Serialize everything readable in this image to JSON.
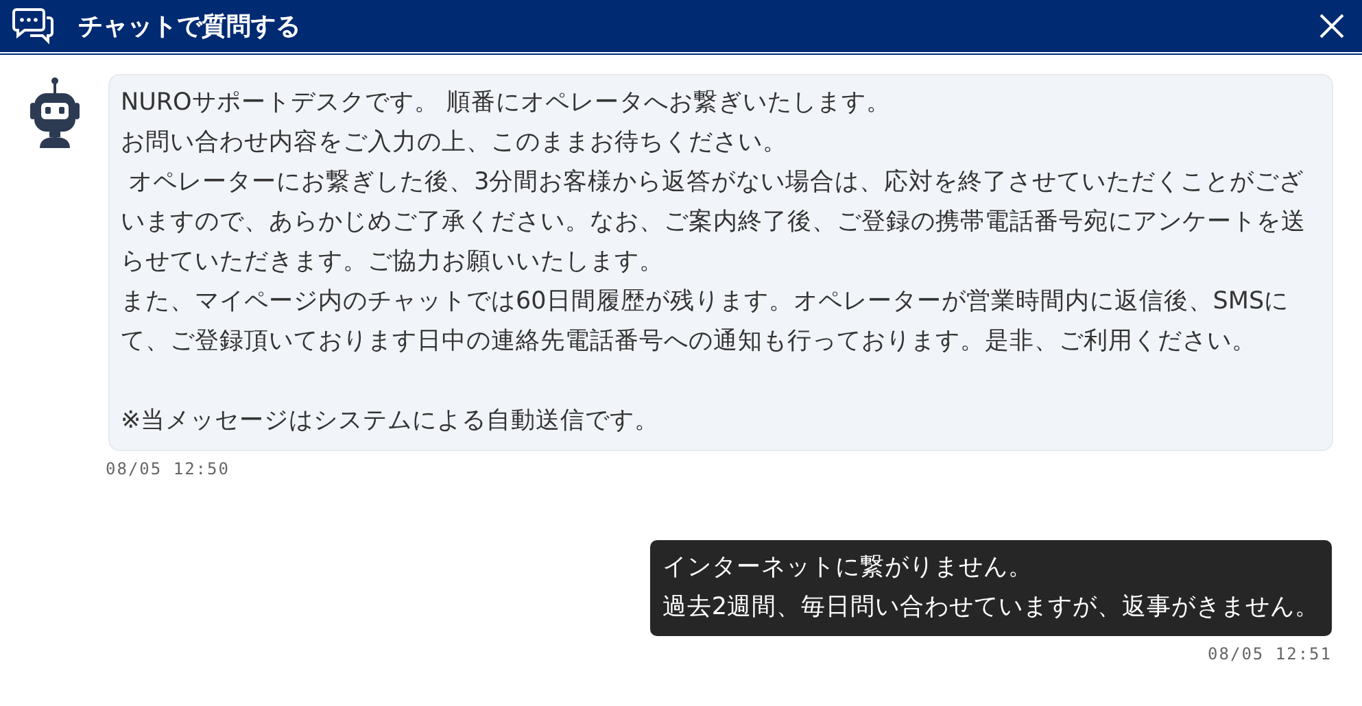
{
  "header": {
    "title": "チャットで質問する"
  },
  "messages": [
    {
      "kind": "bot",
      "paragraphs": [
        "NUROサポートデスクです。 順番にオペレータへお繋ぎいたします。",
        "お問い合わせ内容をご入力の上、このままお待ちください。",
        " オペレーターにお繋ぎした後、3分間お客様から返答がない場合は、応対を終了させていただくことがございますので、あらかじめご了承ください。なお、ご案内終了後、ご登録の携帯電話番号宛にアンケートを送らせていただきます。ご協力お願いいたします。",
        "また、マイページ内のチャットでは60日間履歴が残ります。オペレーターが営業時間内に返信後、SMSにて、ご登録頂いております日中の連絡先電話番号への通知も行っております。是非、ご利用ください。"
      ],
      "note": "※当メッセージはシステムによる自動送信です。",
      "time": "08/05 12:50"
    },
    {
      "kind": "user",
      "paragraphs": [
        "インターネットに繋がりません。",
        "過去2週間、毎日問い合わせていますが、返事がきません。"
      ],
      "time": "08/05 12:51"
    }
  ]
}
